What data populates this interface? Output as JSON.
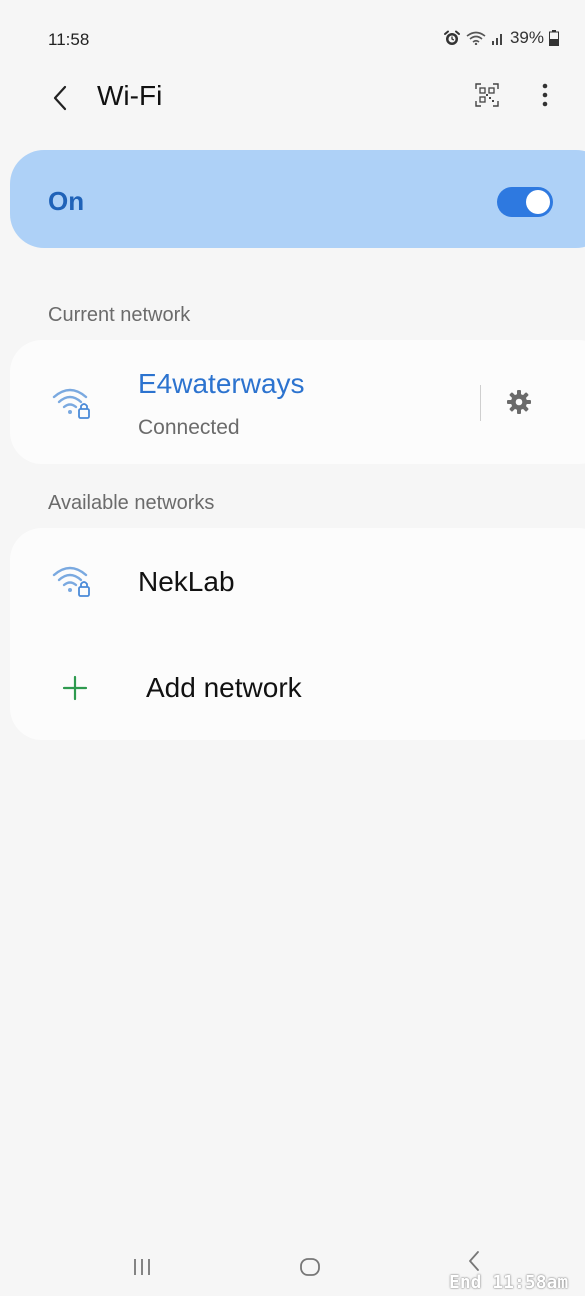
{
  "status_bar": {
    "time": "11:58",
    "battery": "39%",
    "icons": [
      "alarm-icon",
      "wifi-status-icon",
      "cell-signal-icon",
      "battery-icon"
    ]
  },
  "header": {
    "title": "Wi-Fi",
    "icons": [
      "back-chevron-icon",
      "qr-code-icon",
      "more-vertical-icon"
    ]
  },
  "wifi_toggle": {
    "label": "On",
    "state": true,
    "accent_color": "#2e79e0",
    "bar_color": "#aed1f7"
  },
  "current_network": {
    "section_label": "Current network",
    "name": "E4waterways",
    "status": "Connected",
    "icons": [
      "wifi-locked-icon",
      "gear-icon"
    ],
    "name_color": "#2c73cf"
  },
  "available_networks": {
    "section_label": "Available networks",
    "items": [
      {
        "name": "NekLab",
        "icon": "wifi-locked-icon"
      }
    ],
    "add_label": "Add network",
    "add_icon": "plus-icon",
    "add_icon_color": "#2e9a4f"
  },
  "nav_bar": {
    "icons": [
      "recents-icon",
      "home-icon",
      "back-icon"
    ]
  },
  "watermark": "End 11:58am"
}
